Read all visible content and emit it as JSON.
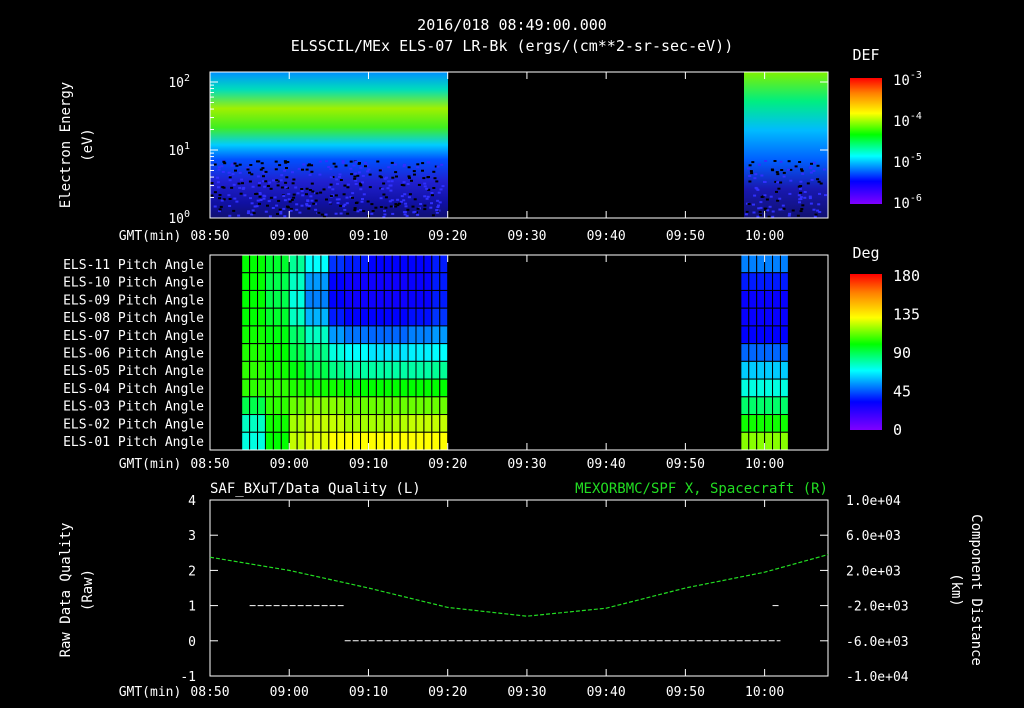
{
  "header": {
    "time": "2016/018 08:49:00.000",
    "subtitle": "ELSSCIL/MEx ELS-07 LR-Bk  (ergs/(cm**2-sr-sec-eV))"
  },
  "gmt_label": "GMT(min)",
  "time_ticks": [
    "08:50",
    "09:00",
    "09:10",
    "09:20",
    "09:30",
    "09:40",
    "09:50",
    "10:00"
  ],
  "colors": {
    "trace_green": "#22dd22",
    "frame": "#ffffff",
    "background": "#000000"
  },
  "chart_data": [
    {
      "type": "heatmap",
      "name": "energy-spectrogram",
      "ylabel": "Electron Energy",
      "ylabel2": "(eV)",
      "y_scale": "log",
      "ylim": [
        1,
        150
      ],
      "y_ticks": [
        {
          "base": "10",
          "exp": "0",
          "value": 1
        },
        {
          "base": "10",
          "exp": "1",
          "value": 10
        },
        {
          "base": "10",
          "exp": "2",
          "value": 100
        }
      ],
      "xlim": [
        "08:50",
        "10:08"
      ],
      "data_segments": [
        [
          "08:50",
          "09:19"
        ],
        [
          "09:57",
          "10:08"
        ]
      ],
      "colorbar": {
        "title": "DEF",
        "ticks": [
          {
            "base": "10",
            "exp": "-3"
          },
          {
            "base": "10",
            "exp": "-4"
          },
          {
            "base": "10",
            "exp": "-5"
          },
          {
            "base": "10",
            "exp": "-6"
          }
        ]
      }
    },
    {
      "type": "heatmap",
      "name": "pitch-angle",
      "rows": [
        "ELS-11 Pitch Angle",
        "ELS-10 Pitch Angle",
        "ELS-09 Pitch Angle",
        "ELS-08 Pitch Angle",
        "ELS-07 Pitch Angle",
        "ELS-06 Pitch Angle",
        "ELS-05 Pitch Angle",
        "ELS-04 Pitch Angle",
        "ELS-03 Pitch Angle",
        "ELS-02 Pitch Angle",
        "ELS-01 Pitch Angle"
      ],
      "xlim": [
        "08:50",
        "10:08"
      ],
      "data_segments": [
        [
          "08:54",
          "09:20"
        ],
        [
          "09:57",
          "10:03"
        ]
      ],
      "colorbar": {
        "title": "Deg",
        "ticks": [
          "180",
          "135",
          "90",
          "45",
          "0"
        ],
        "range": [
          0,
          180
        ]
      }
    },
    {
      "type": "line",
      "name": "quality-and-position",
      "title_left": "SAF_BXuT/Data Quality (L)",
      "title_right": "MEXORBMC/SPF X, Spacecraft (R)",
      "ylabel": "Raw Data Quality",
      "ylabel2": "(Raw)",
      "ylim": [
        -1,
        4
      ],
      "y_ticks": [
        "4",
        "3",
        "2",
        "1",
        "0",
        "-1"
      ],
      "ylabel_right": "Component Distance",
      "ylabel_right2": "(km)",
      "ylim_right": [
        -10000,
        10000
      ],
      "y_ticks_right": [
        "1.0e+04",
        "6.0e+03",
        "2.0e+03",
        "-2.0e+03",
        "-6.0e+03",
        "-1.0e+04"
      ],
      "series": [
        {
          "name": "Data Quality",
          "axis": "left",
          "segments": [
            {
              "x": [
                "08:55",
                "09:07"
              ],
              "y": [
                1,
                1
              ]
            },
            {
              "x": [
                "09:07",
                "10:02"
              ],
              "y": [
                0,
                0
              ]
            },
            {
              "x": [
                "10:01",
                "10:02"
              ],
              "y": [
                1,
                1
              ]
            }
          ]
        },
        {
          "name": "SPF X",
          "axis": "right",
          "x": [
            "08:50",
            "09:00",
            "09:10",
            "09:20",
            "09:30",
            "09:40",
            "09:50",
            "10:00",
            "10:08"
          ],
          "y": [
            3500,
            2000,
            0,
            -2200,
            -3200,
            -2300,
            0,
            1800,
            3800
          ]
        }
      ]
    }
  ]
}
